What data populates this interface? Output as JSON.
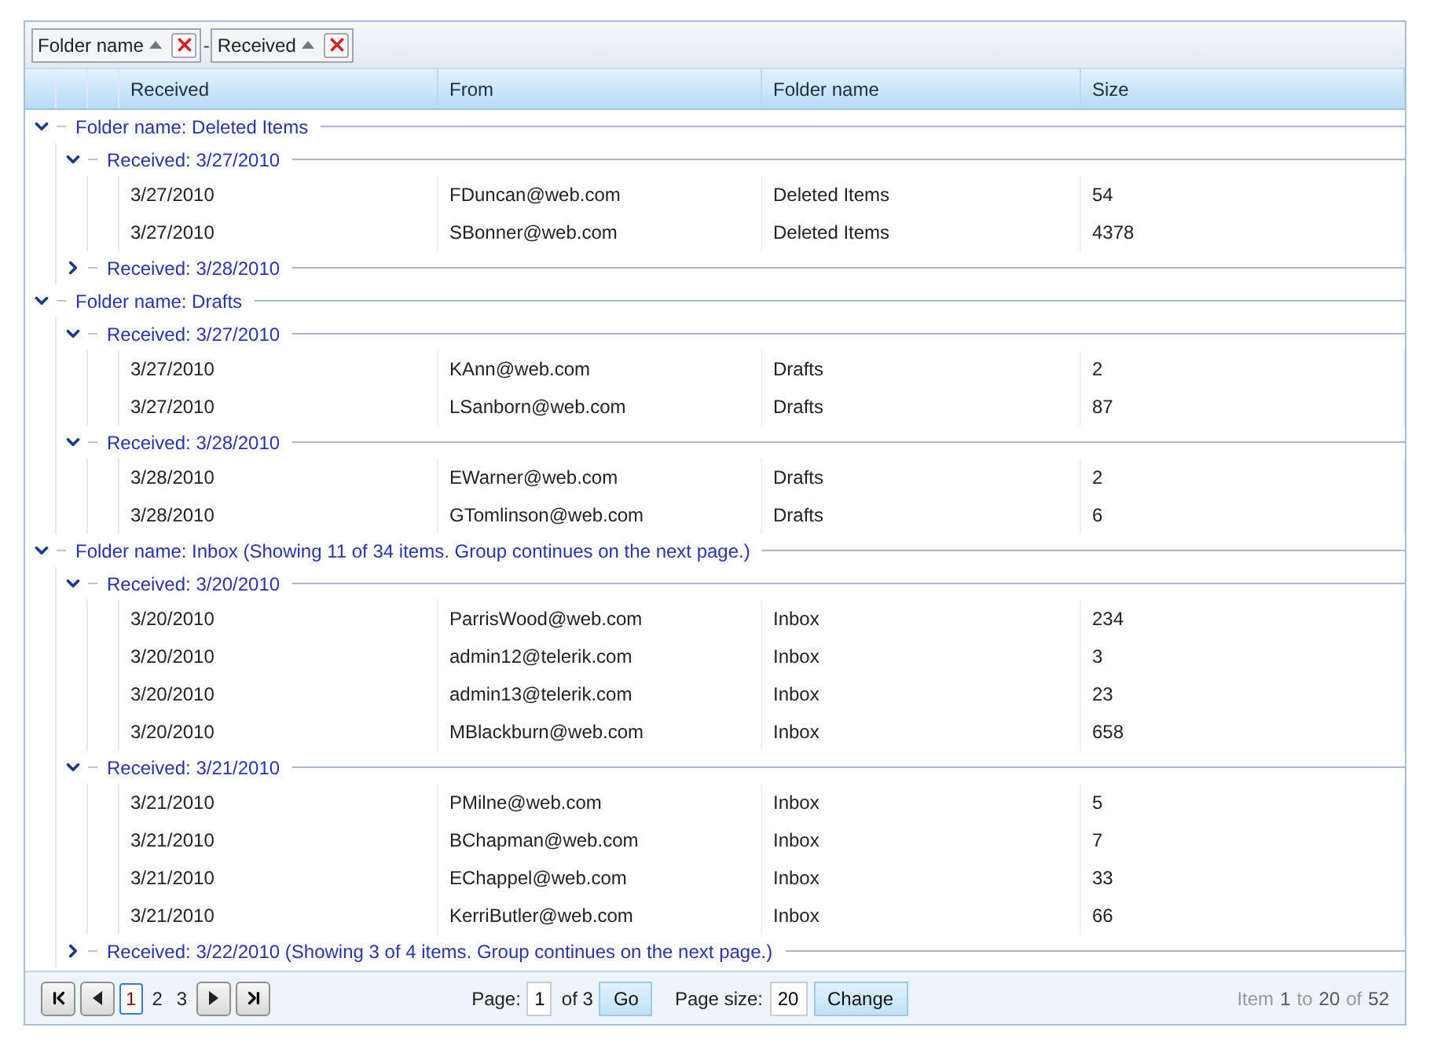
{
  "group_panel": [
    {
      "label": "Folder name",
      "sort_ascending": true
    },
    {
      "label": "Received",
      "sort_ascending": true
    }
  ],
  "group_separator": "-",
  "columns": [
    "Received",
    "From",
    "Folder name",
    "Size"
  ],
  "groups": [
    {
      "label": "Folder name: Deleted Items",
      "expanded": true,
      "children": [
        {
          "label": "Received: 3/27/2010",
          "expanded": true,
          "rows": [
            [
              "3/27/2010",
              "FDuncan@web.com",
              "Deleted Items",
              "54"
            ],
            [
              "3/27/2010",
              "SBonner@web.com",
              "Deleted Items",
              "4378"
            ]
          ]
        },
        {
          "label": "Received: 3/28/2010",
          "expanded": false
        }
      ]
    },
    {
      "label": "Folder name: Drafts",
      "expanded": true,
      "children": [
        {
          "label": "Received: 3/27/2010",
          "expanded": true,
          "rows": [
            [
              "3/27/2010",
              "KAnn@web.com",
              "Drafts",
              "2"
            ],
            [
              "3/27/2010",
              "LSanborn@web.com",
              "Drafts",
              "87"
            ]
          ]
        },
        {
          "label": "Received: 3/28/2010",
          "expanded": true,
          "rows": [
            [
              "3/28/2010",
              "EWarner@web.com",
              "Drafts",
              "2"
            ],
            [
              "3/28/2010",
              "GTomlinson@web.com",
              "Drafts",
              "6"
            ]
          ]
        }
      ]
    },
    {
      "label": "Folder name: Inbox (Showing 11 of 34 items. Group continues on the next page.)",
      "expanded": true,
      "children": [
        {
          "label": "Received: 3/20/2010",
          "expanded": true,
          "rows": [
            [
              "3/20/2010",
              "ParrisWood@web.com",
              "Inbox",
              "234"
            ],
            [
              "3/20/2010",
              "admin12@telerik.com",
              "Inbox",
              "3"
            ],
            [
              "3/20/2010",
              "admin13@telerik.com",
              "Inbox",
              "23"
            ],
            [
              "3/20/2010",
              "MBlackburn@web.com",
              "Inbox",
              "658"
            ]
          ]
        },
        {
          "label": "Received: 3/21/2010",
          "expanded": true,
          "rows": [
            [
              "3/21/2010",
              "PMilne@web.com",
              "Inbox",
              "5"
            ],
            [
              "3/21/2010",
              "BChapman@web.com",
              "Inbox",
              "7"
            ],
            [
              "3/21/2010",
              "EChappel@web.com",
              "Inbox",
              "33"
            ],
            [
              "3/21/2010",
              "KerriButler@web.com",
              "Inbox",
              "66"
            ]
          ]
        },
        {
          "label": "Received: 3/22/2010 (Showing 3 of 4 items. Group continues on the next page.)",
          "expanded": false
        }
      ]
    }
  ],
  "pager": {
    "pages": [
      {
        "label": "1",
        "selected": true
      },
      {
        "label": "2",
        "selected": false
      },
      {
        "label": "3",
        "selected": false
      }
    ],
    "page_label": "Page:",
    "page_value": "1",
    "page_of": "of 3",
    "go_button": "Go",
    "page_size_label": "Page size:",
    "page_size_value": "20",
    "change_button": "Change",
    "summary": [
      {
        "text": "Item",
        "strong": false
      },
      {
        "text": "1",
        "strong": true
      },
      {
        "text": "to",
        "strong": false
      },
      {
        "text": "20",
        "strong": true
      },
      {
        "text": "of",
        "strong": false
      },
      {
        "text": "52",
        "strong": true
      }
    ]
  }
}
